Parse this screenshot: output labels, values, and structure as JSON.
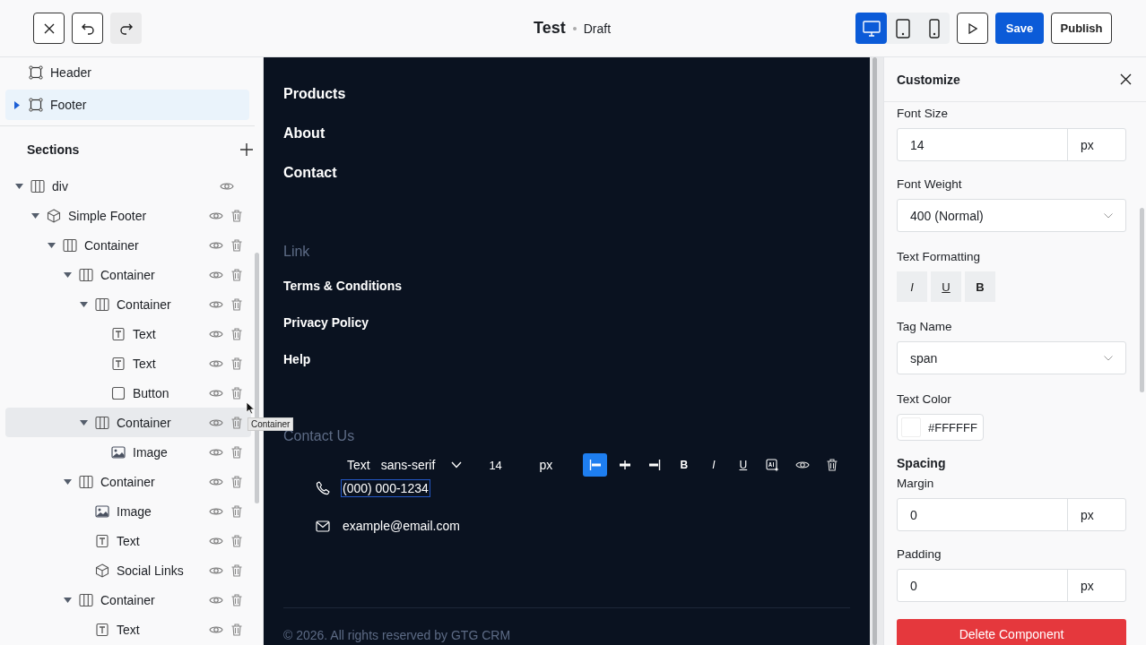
{
  "toolbar": [
    {
      "kind": "close",
      "disabled": false
    },
    {
      "kind": "undo",
      "disabled": false
    },
    {
      "kind": "redo",
      "disabled": true
    }
  ],
  "title": "Test",
  "status": "Draft",
  "devices": [
    {
      "kind": "desktop",
      "selected": true
    },
    {
      "kind": "tablet",
      "selected": false
    },
    {
      "kind": "mobile",
      "selected": false
    }
  ],
  "save": "Save",
  "publish": "Publish",
  "layers": [
    {
      "label": "Header",
      "caret": false,
      "selected": false
    },
    {
      "label": "Footer",
      "caret": true,
      "selected": true
    }
  ],
  "sections": {
    "title": "Sections",
    "tree": [
      {
        "label": "div",
        "kind": "columns",
        "expanded": true,
        "highlighted": false,
        "deletable": false,
        "children": [
          {
            "label": "Simple Footer",
            "kind": "cube",
            "expanded": true,
            "highlighted": false,
            "deletable": true,
            "children": [
              {
                "label": "Container",
                "kind": "columns",
                "expanded": true,
                "highlighted": false,
                "deletable": true,
                "children": [
                  {
                    "label": "Container",
                    "kind": "columns",
                    "expanded": true,
                    "highlighted": false,
                    "deletable": true,
                    "children": [
                      {
                        "label": "Container",
                        "kind": "columns",
                        "expanded": true,
                        "highlighted": false,
                        "deletable": true,
                        "children": [
                          {
                            "label": "Text",
                            "kind": "text",
                            "highlighted": false,
                            "deletable": true
                          },
                          {
                            "label": "Text",
                            "kind": "text",
                            "highlighted": false,
                            "deletable": true
                          },
                          {
                            "label": "Button",
                            "kind": "button",
                            "highlighted": false,
                            "deletable": true
                          }
                        ]
                      },
                      {
                        "label": "Container",
                        "kind": "columns",
                        "expanded": true,
                        "highlighted": true,
                        "deletable": true,
                        "children": [
                          {
                            "label": "Image",
                            "kind": "image",
                            "highlighted": false,
                            "deletable": true
                          }
                        ]
                      }
                    ]
                  },
                  {
                    "label": "Container",
                    "kind": "columns",
                    "expanded": true,
                    "highlighted": false,
                    "deletable": true,
                    "children": [
                      {
                        "label": "Image",
                        "kind": "image",
                        "highlighted": false,
                        "deletable": true
                      },
                      {
                        "label": "Text",
                        "kind": "text",
                        "highlighted": false,
                        "deletable": true
                      },
                      {
                        "label": "Social Links",
                        "kind": "cube",
                        "highlighted": false,
                        "deletable": true
                      }
                    ]
                  },
                  {
                    "label": "Container",
                    "kind": "columns",
                    "expanded": true,
                    "highlighted": false,
                    "deletable": true,
                    "children": [
                      {
                        "label": "Text",
                        "kind": "text",
                        "highlighted": false,
                        "deletable": true
                      }
                    ]
                  }
                ]
              }
            ]
          }
        ]
      }
    ]
  },
  "tooltip": "Container",
  "canvas": {
    "nav": [
      "Products",
      "About",
      "Contact"
    ],
    "link_heading": "Link",
    "links": [
      "Terms & Conditions",
      "Privacy Policy",
      "Help"
    ],
    "contact_heading": "Contact Us",
    "contacts": [
      {
        "kind": "phone",
        "text": "(000) 000-1234",
        "selected": true
      },
      {
        "kind": "email",
        "text": "example@email.com",
        "selected": false
      }
    ],
    "copyright": "© 2026. All rights reserved by GTG CRM"
  },
  "text_toolbar": {
    "tag": "Text",
    "font": "sans-serif",
    "size": "14",
    "unit": "px",
    "align": [
      {
        "kind": "left",
        "selected": true
      },
      {
        "kind": "center",
        "selected": false
      },
      {
        "kind": "right",
        "selected": false
      }
    ],
    "tools": [
      {
        "kind": "bold",
        "label": "B"
      },
      {
        "kind": "italic",
        "label": "I"
      },
      {
        "kind": "underline",
        "label": "U"
      },
      {
        "kind": "ai"
      },
      {
        "kind": "eye"
      },
      {
        "kind": "trash"
      }
    ]
  },
  "panel": {
    "title": "Customize",
    "font_size": {
      "label": "Font Size",
      "value": "14",
      "unit": "px"
    },
    "font_weight": {
      "label": "Font Weight",
      "value": "400 (Normal)"
    },
    "formatting": {
      "label": "Text Formatting",
      "buttons": [
        {
          "kind": "italic",
          "label": "I"
        },
        {
          "kind": "underline",
          "label": "U"
        },
        {
          "kind": "bold",
          "label": "B"
        }
      ]
    },
    "tag_name": {
      "label": "Tag Name",
      "value": "span"
    },
    "text_color": {
      "label": "Text Color",
      "value": "#FFFFFF"
    },
    "spacing": {
      "title": "Spacing",
      "fields": [
        {
          "label": "Margin",
          "value": "0",
          "unit": "px"
        },
        {
          "label": "Padding",
          "value": "0",
          "unit": "px"
        }
      ]
    },
    "delete": "Delete Component"
  }
}
